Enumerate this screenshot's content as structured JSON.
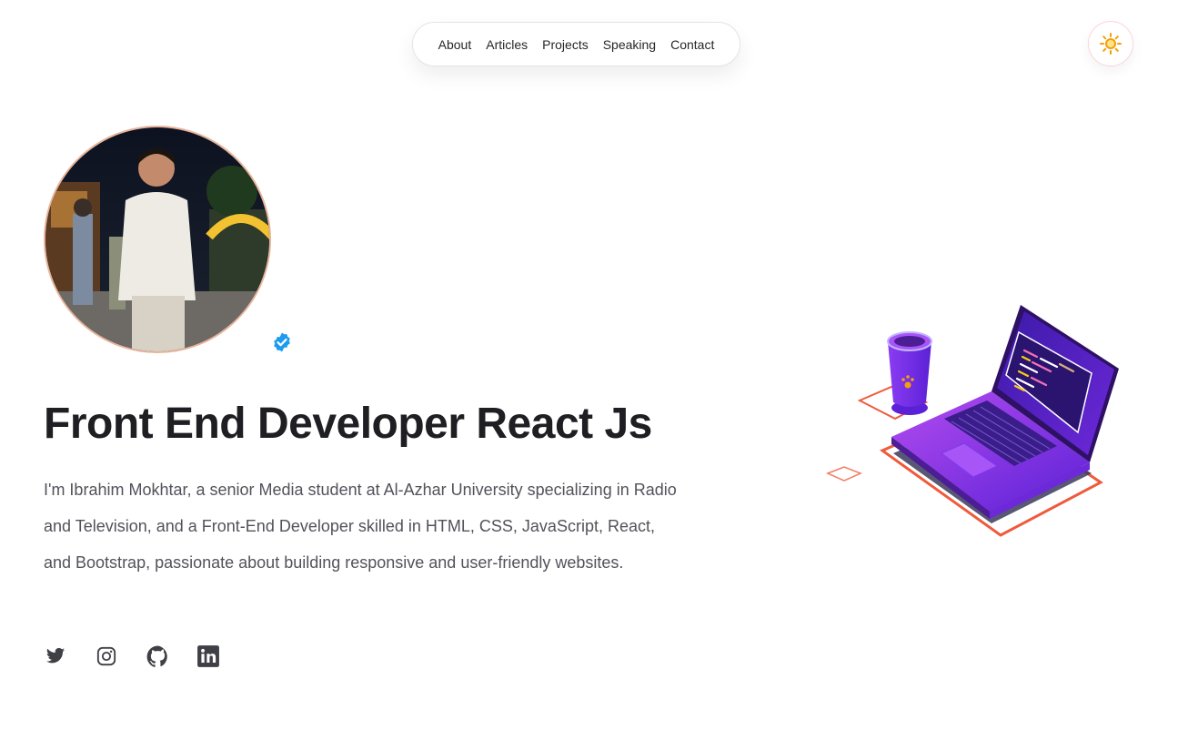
{
  "nav": {
    "items": [
      {
        "label": "About"
      },
      {
        "label": "Articles"
      },
      {
        "label": "Projects"
      },
      {
        "label": "Speaking"
      },
      {
        "label": "Contact"
      }
    ]
  },
  "theme_toggle": {
    "icon": "sun-icon",
    "color": "#f59e0b"
  },
  "hero": {
    "headline": "Front End Developer React Js",
    "bio": "I'm Ibrahim Mokhtar, a senior Media student at Al-Azhar University specializing in Radio and Television, and a Front-End Developer skilled in HTML, CSS, JavaScript, React, and Bootstrap, passionate about building responsive and user-friendly websites.",
    "verified_badge_color": "#1d9bf0"
  },
  "socials": [
    {
      "icon": "twitter-icon"
    },
    {
      "icon": "instagram-icon"
    },
    {
      "icon": "github-icon"
    },
    {
      "icon": "linkedin-icon"
    }
  ],
  "colors": {
    "text_primary": "#1f1f23",
    "text_secondary": "#52525b",
    "laptop_purple": "#7c3aed",
    "accent_orange": "#ef5a3c"
  }
}
